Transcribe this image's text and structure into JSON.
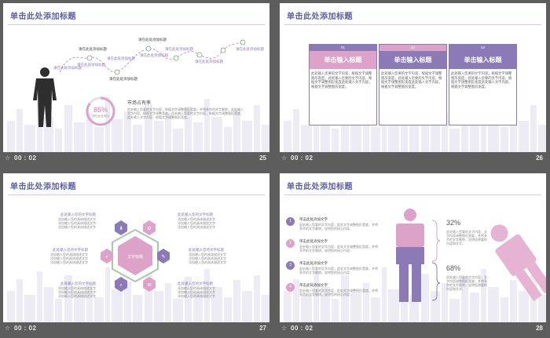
{
  "slides": [
    {
      "title": "单击此处添加标题",
      "time": "00 : 02",
      "number": "25",
      "timeline": [
        {
          "label": "请在此处添加标题"
        },
        {
          "label": "请在此处添加标题"
        },
        {
          "label": "请在此处添加标题"
        },
        {
          "label": "请在此处添加标题"
        },
        {
          "label": "请在此处添加标题"
        },
        {
          "label": "请在此处添加标题"
        },
        {
          "label": "请在此处添加标题"
        },
        {
          "label": "请在此处添加标题"
        },
        {
          "label": "请在此处添加标题"
        },
        {
          "label": "请在此处添加标题"
        }
      ],
      "percent_value": "85%",
      "percent_caption": "请在此处添加",
      "percent_fraction": 0.85,
      "market_heading": "市场占有率",
      "market_text": "此处输入您要的文字内容，根据文字调整图形宽度，并将多余的文字删除。此处输入文字内容，根据文字调整宽度，此处输入您要的文字内容，根据文字调整图形宽度，此处输入文字内容，根据文字调整图形宽度。"
    },
    {
      "title": "单击此处添加标题",
      "time": "00 : 02",
      "number": "26",
      "cards": [
        {
          "index": "01",
          "heading": "单击输入标题",
          "body": "此处输入您要的文字内容，根据文字调整图形宽度，此处输入您要的文字内容，根据文字调整图形宽度此处输入文字内容，根据文字调整图形宽度。",
          "head_color": "#8c7ab7",
          "title_color": "#dca2c7"
        },
        {
          "index": "02",
          "heading": "单击输入标题",
          "body": "此处输入您要的文字内容，根据文字调整图形宽度，此处输入您要的文字内容，根据文字调整图形宽度此处输入文字内容，根据文字调整图形宽度。",
          "head_color": "#dca2c7",
          "title_color": "#8c7ab7"
        },
        {
          "index": "03",
          "heading": "单击输入标题",
          "body": "此处输入您要的文字内容，根据文字调整图形宽度，此处输入您要的文字内容，根据文字调整图形宽度此处输入文字内容，根据文字调整图形宽度。",
          "head_color": "#8c7ab7",
          "title_color": "#8c7ab7"
        }
      ]
    },
    {
      "title": "单击此处添加标题",
      "time": "00 : 02",
      "number": "27",
      "center_text": "文字标题",
      "items": [
        {
          "heading": "此处输入您的文字标题",
          "lines": [
            "添加输入您的具体描述文字",
            "添加输入您的具体描述文字",
            "添加输入您的具体描述文字"
          ]
        },
        {
          "heading": "此处输入您的文字标题",
          "lines": [
            "添加输入您的具体描述文字",
            "添加输入您的具体描述文字",
            "添加输入您的具体描述文字"
          ]
        },
        {
          "heading": "此处输入您的文字标题",
          "lines": [
            "添加输入您的具体描述文字",
            "添加输入您的具体描述文字",
            "添加输入您的具体描述文字"
          ]
        },
        {
          "heading": "此处输入您的文字标题",
          "lines": [
            "添加输入您的具体描述文字",
            "添加输入您的具体描述文字",
            "添加输入您的具体描述文字"
          ]
        },
        {
          "heading": "此处输入您的文字标题",
          "lines": [
            "添加输入您的具体描述文字",
            "添加输入您的具体描述文字",
            "添加输入您的具体描述文字"
          ]
        },
        {
          "heading": "此处输入您的文字标题",
          "lines": [
            "添加输入您的具体描述文字",
            "添加输入您的具体描述文字",
            "添加输入您的具体描述文字"
          ]
        }
      ],
      "hex_icons": [
        "download-icon",
        "gear-icon",
        "rocket-icon",
        "tag-icon",
        "search-icon",
        "chat-icon"
      ]
    },
    {
      "title": "单击此处添加标题",
      "time": "00 : 02",
      "number": "28",
      "list": [
        {
          "num": "1",
          "heading": "单击此处添加文字",
          "text": "此处输入您要的文字内容，此处文字调整图形宽度，并将多余的文字删除。说明您的核心内容...",
          "color": "#8c7ab7"
        },
        {
          "num": "2",
          "heading": "单击此处添加文字",
          "text": "此处输入您要的文字内容，此处文字调整图形宽度，并将多余的文字删除。说明您的核心内容...",
          "color": "#dca2c7"
        },
        {
          "num": "3",
          "heading": "单击此处添加文字",
          "text": "此处输入您要的文字内容，此处文字调整图形宽度，并将多余的文字删除。说明您的核心内容...",
          "color": "#8c7ab7"
        },
        {
          "num": "4",
          "heading": "单击此处添加文字",
          "text": "此处输入您要的文字内容，此处文字调整图形宽度，并将多余的文字删除。说明您的核心内容...",
          "color": "#dca2c7"
        }
      ],
      "stats": [
        {
          "value": "32%",
          "text": "此处输入您要的文字内容，文字内容调整图形宽度，并将多余的文字删除，说明您想要的内容和文字。"
        },
        {
          "value": "68%",
          "text": "此处输入您要的文字内容，文字内容调整图形宽度，并将多余的文字删除，说明您想要的内容和文字。"
        }
      ]
    }
  ],
  "colors": {
    "purple": "#8c7ab7",
    "pink": "#dca2c7",
    "title": "#5e5ea6",
    "background": "#5d5d5d"
  }
}
